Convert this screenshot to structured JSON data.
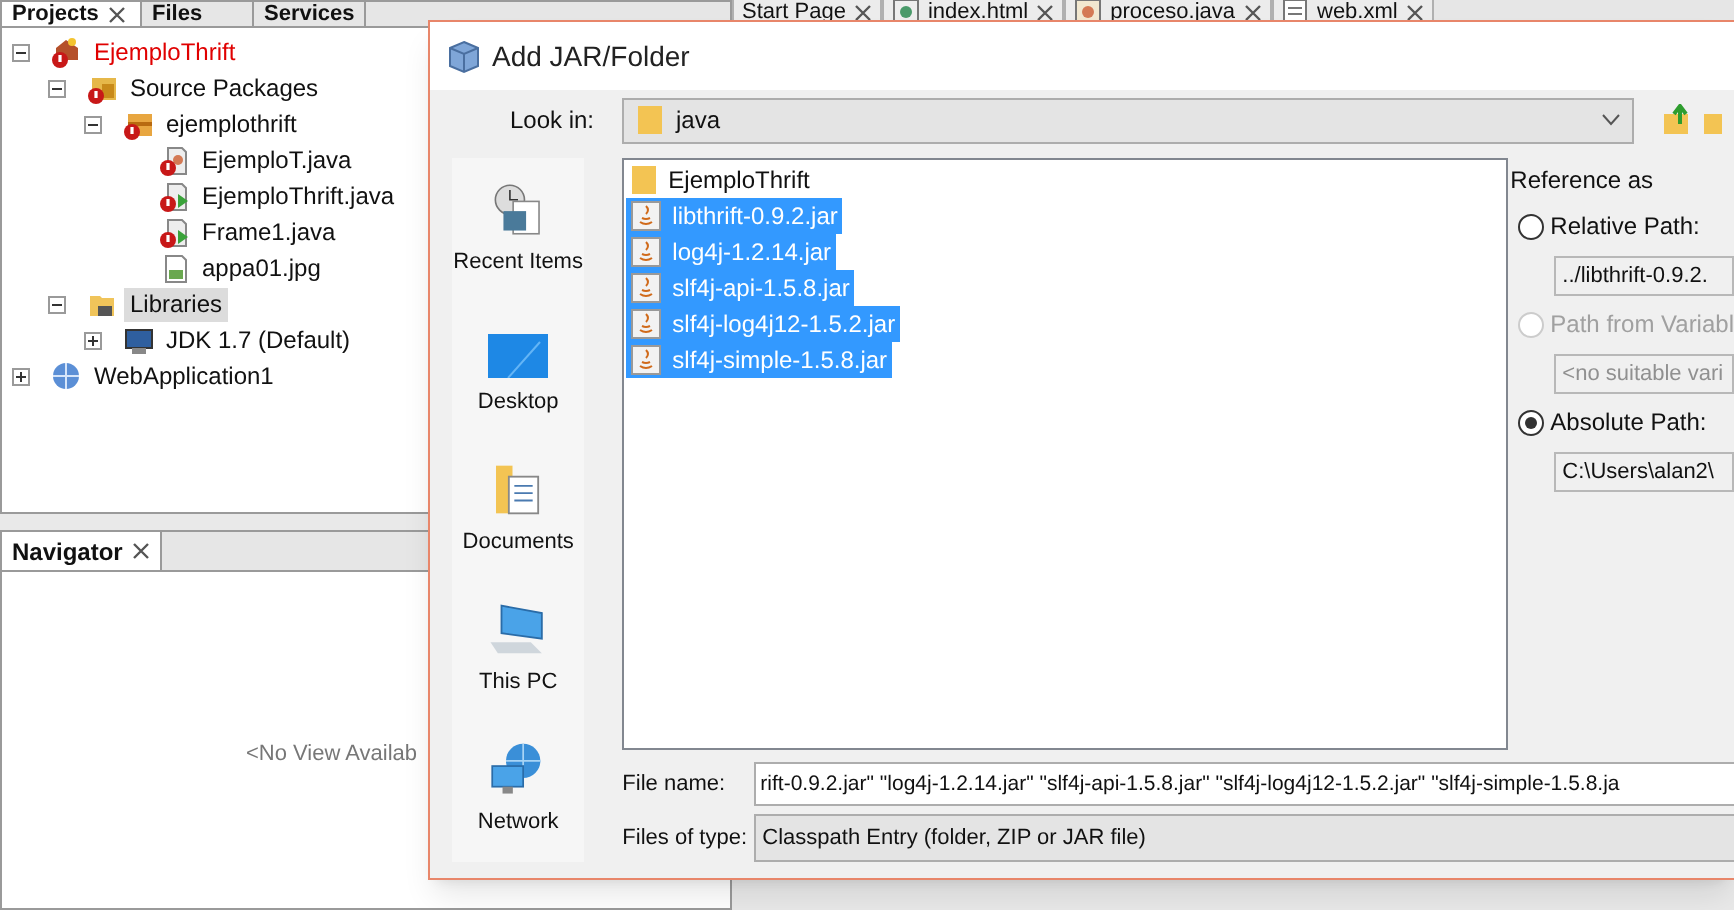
{
  "ide": {
    "project_tabs": [
      {
        "label": "Projects",
        "selected": true,
        "closable": true
      },
      {
        "label": "Files",
        "selected": false,
        "closable": false
      },
      {
        "label": "Services",
        "selected": false,
        "closable": false
      }
    ],
    "tree": [
      {
        "label": "EjemploThrift",
        "kind": "project",
        "error": true,
        "expanded": true,
        "selected": false,
        "children": [
          {
            "label": "Source Packages",
            "kind": "sources",
            "error": true,
            "expanded": true,
            "selected": false,
            "children": [
              {
                "label": "ejemplothrift",
                "kind": "package",
                "error": true,
                "expanded": true,
                "selected": false,
                "children": [
                  {
                    "label": "EjemploT.java",
                    "kind": "java",
                    "error": true,
                    "selected": false
                  },
                  {
                    "label": "EjemploThrift.java",
                    "kind": "java-main",
                    "error": true,
                    "selected": false
                  },
                  {
                    "label": "Frame1.java",
                    "kind": "java-main",
                    "error": true,
                    "selected": false
                  },
                  {
                    "label": "appa01.jpg",
                    "kind": "image",
                    "error": false,
                    "selected": false
                  }
                ]
              }
            ]
          },
          {
            "label": "Libraries",
            "kind": "libraries",
            "error": false,
            "expanded": true,
            "selected": true,
            "children": [
              {
                "label": "JDK 1.7 (Default)",
                "kind": "jdk",
                "error": false,
                "expanded": false,
                "selected": false
              }
            ]
          }
        ]
      },
      {
        "label": "WebApplication1",
        "kind": "web",
        "error": false,
        "expanded": false,
        "selected": false
      }
    ],
    "navigator": {
      "title": "Navigator",
      "message": "<No View Availab"
    },
    "editor_tabs": [
      {
        "label": "Start Page",
        "kind": "page"
      },
      {
        "label": "index.html",
        "kind": "html"
      },
      {
        "label": "proceso.java",
        "kind": "java"
      },
      {
        "label": "web.xml",
        "kind": "xml"
      }
    ]
  },
  "dialog": {
    "title": "Add JAR/Folder",
    "look_in_label": "Look in:",
    "look_in": "java",
    "places": [
      {
        "label": "Recent Items",
        "kind": "recent"
      },
      {
        "label": "Desktop",
        "kind": "desktop"
      },
      {
        "label": "Documents",
        "kind": "documents"
      },
      {
        "label": "This PC",
        "kind": "pc"
      },
      {
        "label": "Network",
        "kind": "network"
      }
    ],
    "files": [
      {
        "name": "EjemploThrift",
        "kind": "folder",
        "selected": false
      },
      {
        "name": "libthrift-0.9.2.jar",
        "kind": "jar",
        "selected": true
      },
      {
        "name": "log4j-1.2.14.jar",
        "kind": "jar",
        "selected": true
      },
      {
        "name": "slf4j-api-1.5.8.jar",
        "kind": "jar",
        "selected": true
      },
      {
        "name": "slf4j-log4j12-1.5.2.jar",
        "kind": "jar",
        "selected": true
      },
      {
        "name": "slf4j-simple-1.5.8.jar",
        "kind": "jar",
        "selected": true
      }
    ],
    "reference": {
      "title": "Reference as",
      "options": [
        {
          "label": "Relative Path:",
          "selected": false,
          "disabled": false,
          "value": "../libthrift-0.9.2."
        },
        {
          "label": "Path from Variabl",
          "selected": false,
          "disabled": true,
          "value": "<no suitable vari"
        },
        {
          "label": "Absolute Path:",
          "selected": true,
          "disabled": false,
          "value": "C:\\Users\\alan2\\"
        }
      ]
    },
    "file_name_label": "File name:",
    "file_name": "rift-0.9.2.jar\" \"log4j-1.2.14.jar\" \"slf4j-api-1.5.8.jar\" \"slf4j-log4j12-1.5.2.jar\" \"slf4j-simple-1.5.8.ja",
    "file_type_label": "Files of type:",
    "file_type": "Classpath Entry (folder, ZIP or JAR file)"
  }
}
